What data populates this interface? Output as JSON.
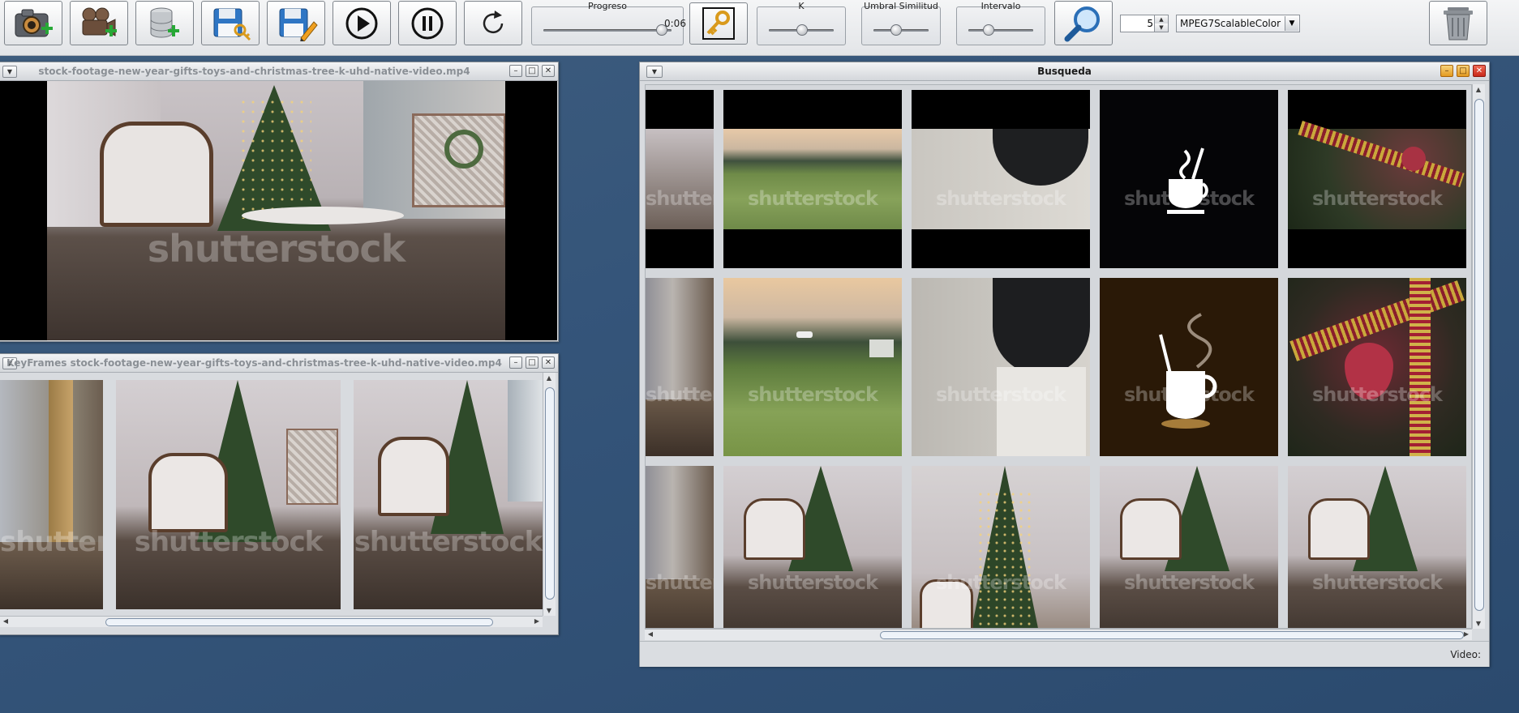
{
  "toolbar": {
    "buttons": [
      {
        "name": "add-image-button",
        "icon": "camera-add-icon"
      },
      {
        "name": "add-video-button",
        "icon": "video-camera-add-icon"
      },
      {
        "name": "add-database-button",
        "icon": "database-add-icon"
      },
      {
        "name": "save-key-button",
        "icon": "save-key-icon"
      },
      {
        "name": "save-edit-button",
        "icon": "save-edit-icon"
      },
      {
        "name": "play-button",
        "icon": "play-icon"
      },
      {
        "name": "pause-button",
        "icon": "pause-icon"
      },
      {
        "name": "reload-button",
        "icon": "refresh-icon"
      }
    ],
    "progress": {
      "label": "Progreso",
      "time": "0:06",
      "level": 0.92
    },
    "keyframe_button_icon": "key-icon",
    "k_slider": {
      "label": "K",
      "level": 0.5
    },
    "threshold_slider": {
      "label": "Umbral Similitud",
      "level": 0.4
    },
    "interval_slider": {
      "label": "Intervalo",
      "level": 0.3
    },
    "search_button_icon": "magnifier-icon",
    "spinner_value": "5",
    "descriptor_select": {
      "value": "MPEG7ScalableColor"
    },
    "trash_button_icon": "trash-icon"
  },
  "video_window": {
    "title": "stock-footage-new-year-gifts-toys-and-christmas-tree-k-uhd-native-video.mp4",
    "watermark": "shutterstock"
  },
  "keyframes_window": {
    "title": "KeyFrames stock-footage-new-year-gifts-toys-and-christmas-tree-k-uhd-native-video.mp4",
    "watermark": "shutterstock"
  },
  "search_window": {
    "title": "Busqueda",
    "status_label": "Video:",
    "watermark": "shutterstock"
  },
  "colors": {
    "desktop": "#35557a",
    "toolbar": "#e8eaed",
    "close_button": "#d23a2a",
    "minimize_button": "#e8a22f"
  }
}
